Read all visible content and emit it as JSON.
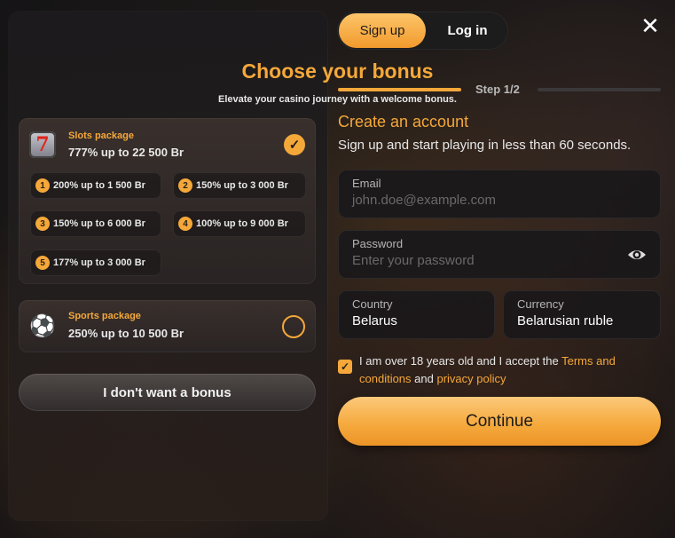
{
  "bonus": {
    "title": "Choose your bonus",
    "subtitle": "Elevate your casino journey with a welcome bonus.",
    "slots": {
      "name": "Slots package",
      "value": "777% up to 22 500 Br",
      "selected": true,
      "icon": "slot-machine-icon",
      "options": [
        {
          "num": "1",
          "label": "200% up to 1 500 Br"
        },
        {
          "num": "2",
          "label": "150% up to 3 000 Br"
        },
        {
          "num": "3",
          "label": "150% up to 6 000 Br"
        },
        {
          "num": "4",
          "label": "100% up to 9 000 Br"
        },
        {
          "num": "5",
          "label": "177% up to 3 000 Br"
        }
      ]
    },
    "sports": {
      "name": "Sports package",
      "value": "250% up to 10 500 Br",
      "selected": false,
      "icon": "soccer-ball-icon"
    },
    "no_bonus_label": "I don't want a bonus"
  },
  "tabs": {
    "signup": "Sign up",
    "login": "Log in",
    "active": "signup"
  },
  "step": {
    "label": "Step 1/2"
  },
  "form": {
    "title": "Create an account",
    "subtitle": "Sign up and start playing in less than 60 seconds.",
    "email": {
      "label": "Email",
      "placeholder": "john.doe@example.com"
    },
    "password": {
      "label": "Password",
      "placeholder": "Enter your password"
    },
    "country": {
      "label": "Country",
      "value": "Belarus"
    },
    "currency": {
      "label": "Currency",
      "value": "Belarusian ruble"
    },
    "terms": {
      "checked": true,
      "text_before": "I am over 18 years old and I accept the ",
      "terms_link": "Terms and conditions",
      "and": " and ",
      "privacy_link": "privacy policy"
    },
    "continue_label": "Continue"
  },
  "colors": {
    "accent": "#f5a83a",
    "panel": "#1c1a1c"
  }
}
